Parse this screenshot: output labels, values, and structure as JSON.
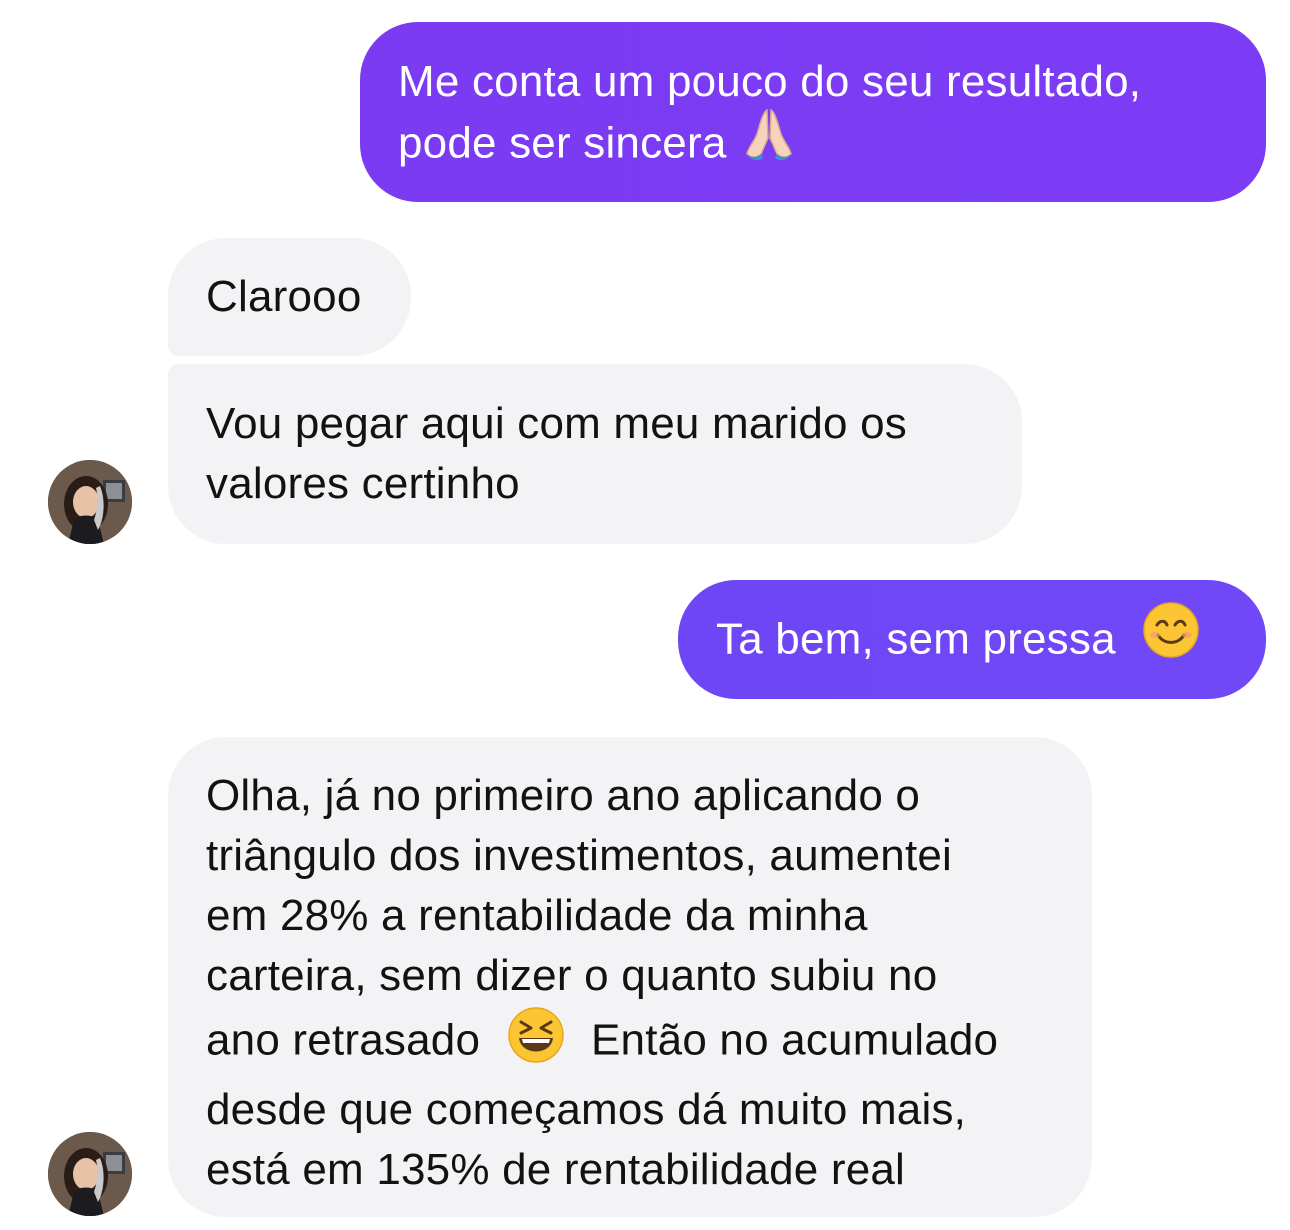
{
  "messages": [
    {
      "direction": "outgoing",
      "text": "Me conta um pouco do seu resultado,\npode ser sincera",
      "emoji": "folded-hands"
    },
    {
      "direction": "incoming",
      "text": "Clarooo"
    },
    {
      "direction": "incoming",
      "text": "Vou pegar aqui com meu marido os\nvalores certinho"
    },
    {
      "direction": "outgoing",
      "text": "Ta bem, sem pressa",
      "emoji": "smiling-face"
    },
    {
      "direction": "incoming",
      "text_before_emoji": "Olha, já no primeiro ano aplicando o\ntriângulo dos investimentos, aumentei\nem 28% a rentabilidade da minha\ncarteira, sem dizer o quanto subiu no\nano retrasado",
      "emoji": "grinning-squinting-face",
      "text_after_emoji": "Então no acumulado\ndesde que começamos dá muito mais,\nestá em 135% de rentabilidade real"
    }
  ],
  "colors": {
    "outgoing_bubble": "#7a3bf2",
    "outgoing_bubble_2": "#6f46f5",
    "incoming_bubble": "#f3f3f5",
    "outgoing_text": "#ffffff",
    "incoming_text": "#121212"
  },
  "avatar": {
    "icon": "contact-avatar-photo"
  }
}
